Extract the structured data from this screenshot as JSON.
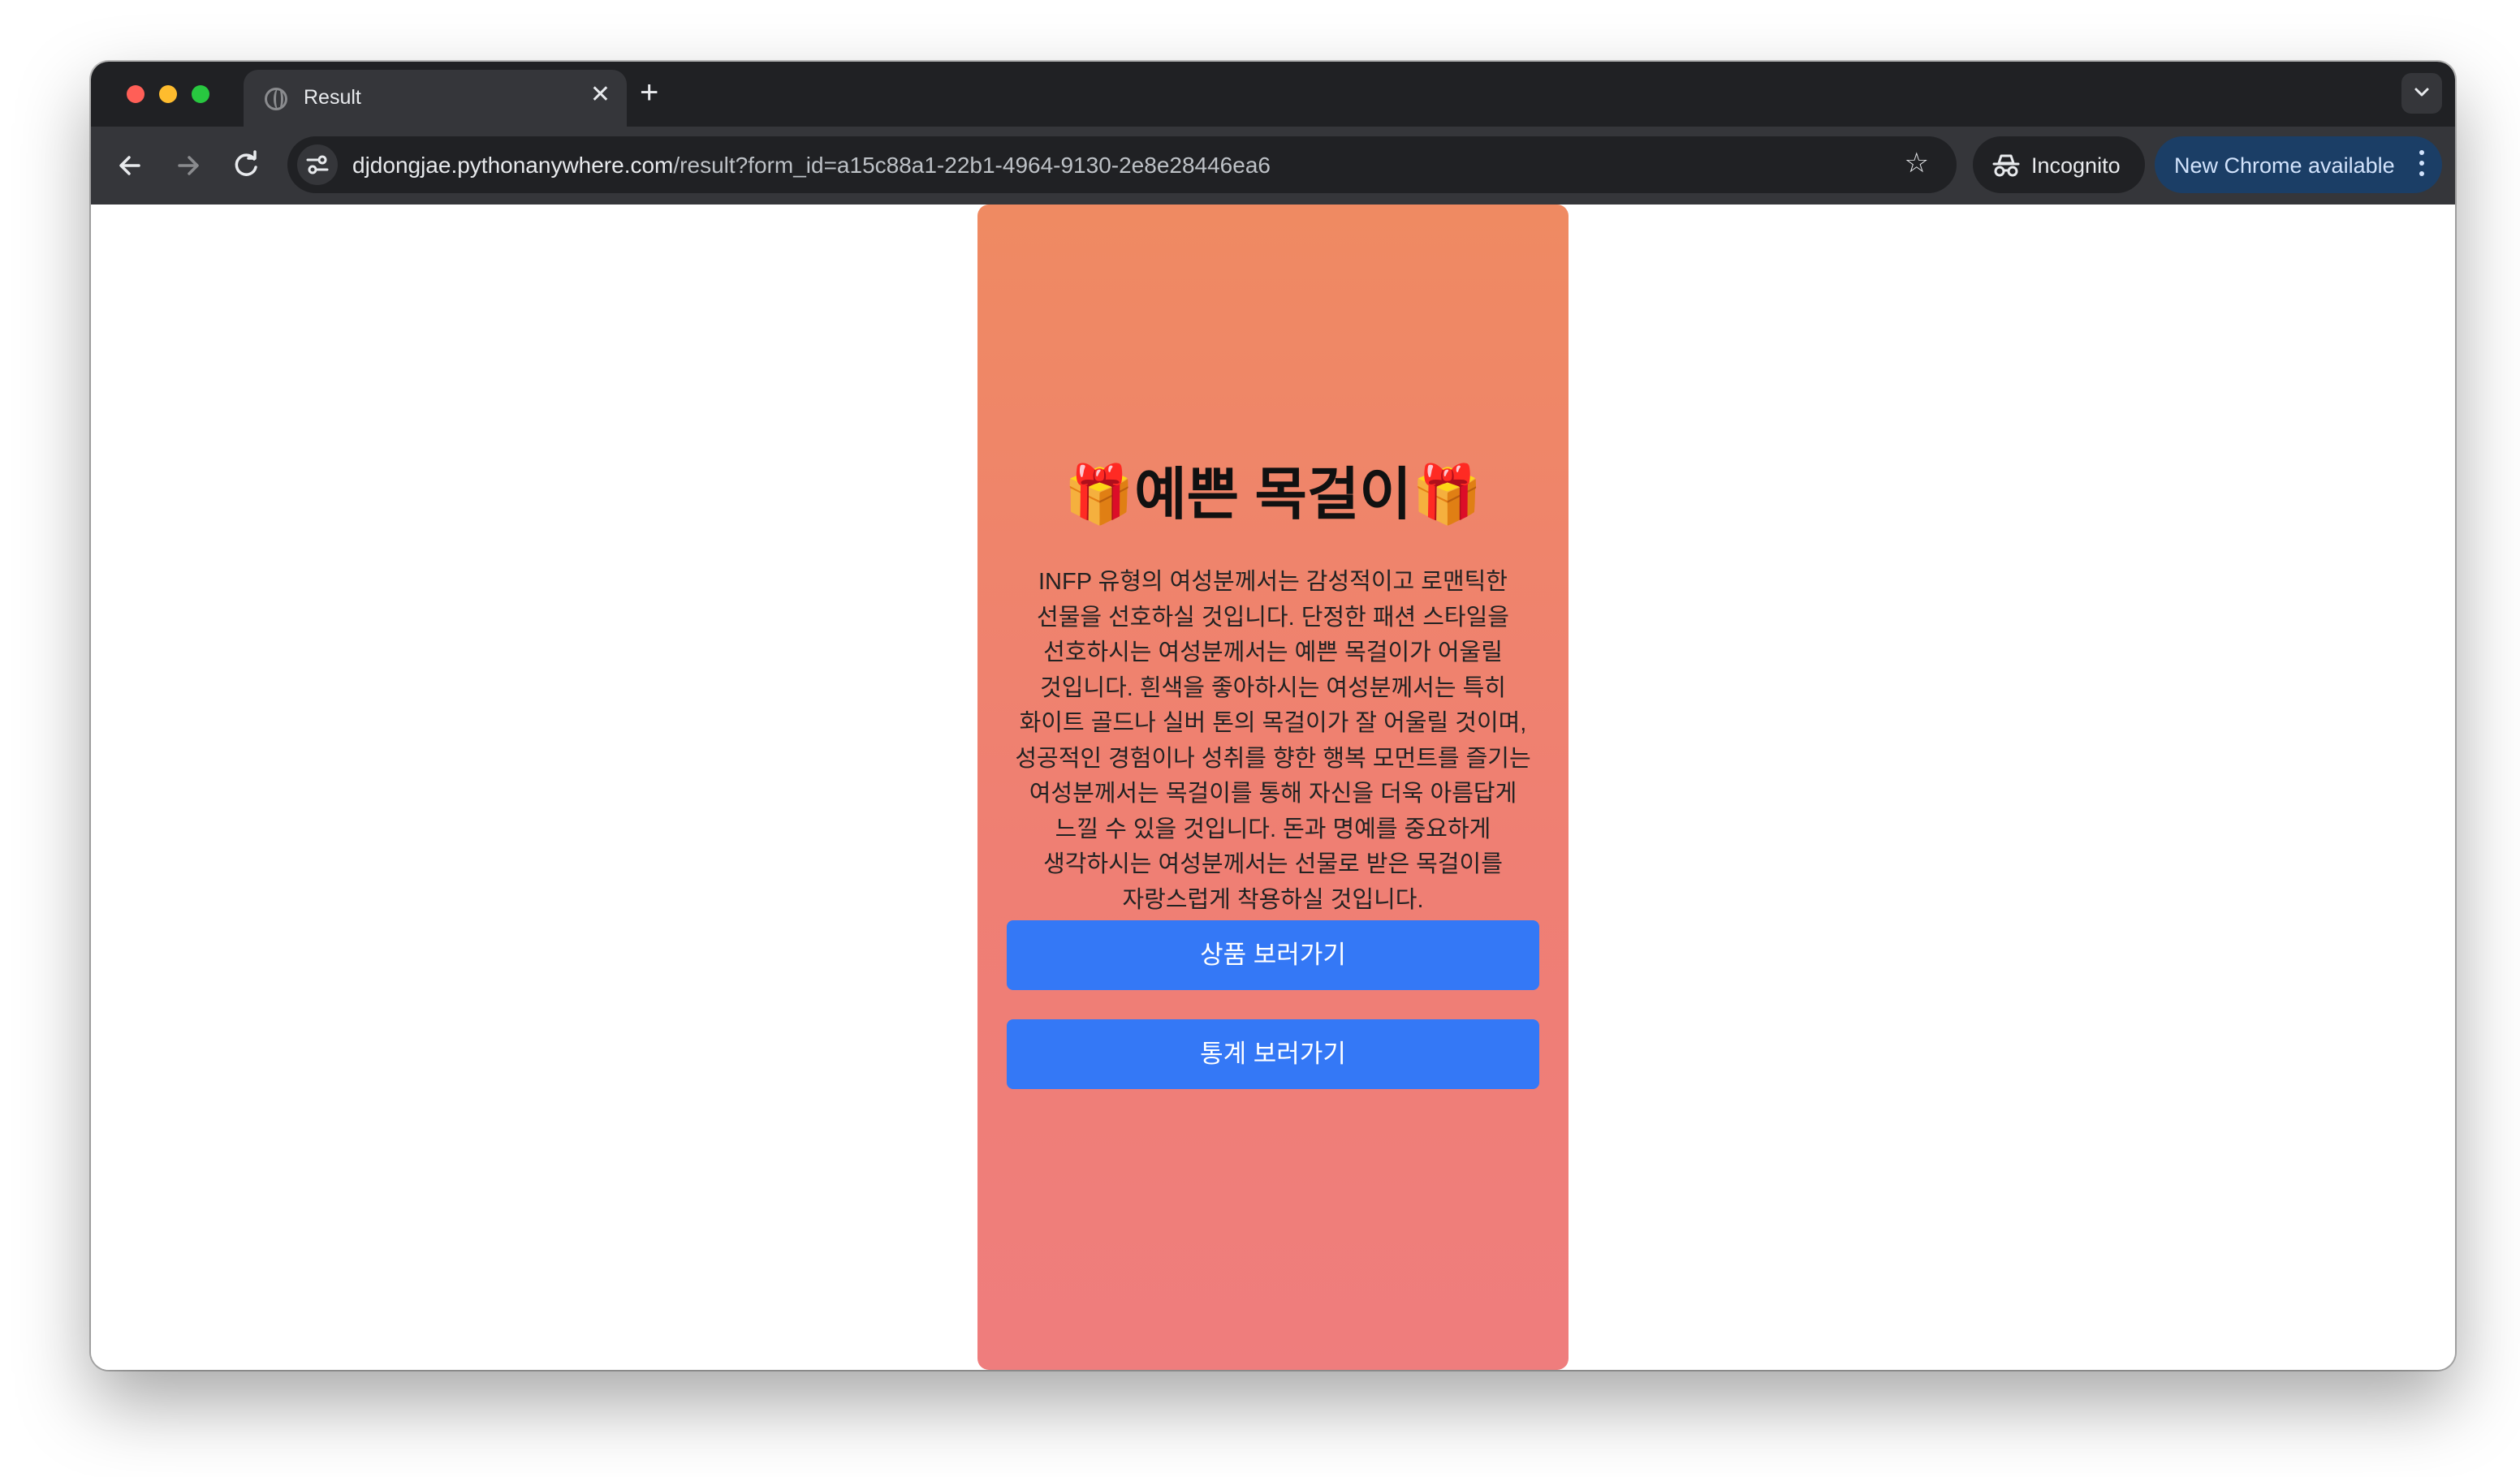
{
  "browser": {
    "tab_title": "Result",
    "tab_close_glyph": "✕",
    "new_tab_glyph": "+",
    "url_domain": "djdongjae.pythonanywhere.com",
    "url_path": "/result?form_id=a15c88a1-22b1-4964-9130-2e8e28446ea6",
    "star_glyph": "☆",
    "incognito_label": "Incognito",
    "update_label": "New Chrome available",
    "icons": [
      "back-arrow-icon",
      "forward-arrow-icon",
      "reload-icon",
      "site-info-icon",
      "bookmark-star-icon",
      "incognito-icon",
      "more-menu-icon",
      "tab-search-chevron-icon",
      "globe-favicon-icon"
    ]
  },
  "result": {
    "title": "🎁예쁜 목걸이🎁",
    "description": "INFP 유형의 여성분께서는 감성적이고 로맨틱한 선물을 선호하실 것입니다. 단정한 패션 스타일을 선호하시는 여성분께서는 예쁜 목걸이가 어울릴 것입니다. 흰색을 좋아하시는 여성분께서는 특히 화이트 골드나 실버 톤의 목걸이가 잘 어울릴 것이며, 성공적인 경험이나 성취를 향한 행복 모먼트를 즐기는 여성분께서는 목걸이를 통해 자신을 더욱 아름답게 느낄 수 있을 것입니다. 돈과 명예를 중요하게 생각하시는 여성분께서는 선물로 받은 목걸이를 자랑스럽게 착용하실 것입니다.",
    "view_product_label": "상품 보러가기",
    "view_stats_label": "통계 보러가기"
  },
  "colors": {
    "card_gradient_top": "#ef8a62",
    "card_gradient_bottom": "#ef7d7d",
    "button_blue": "#3478f6",
    "update_chip": "#1b3e66"
  }
}
